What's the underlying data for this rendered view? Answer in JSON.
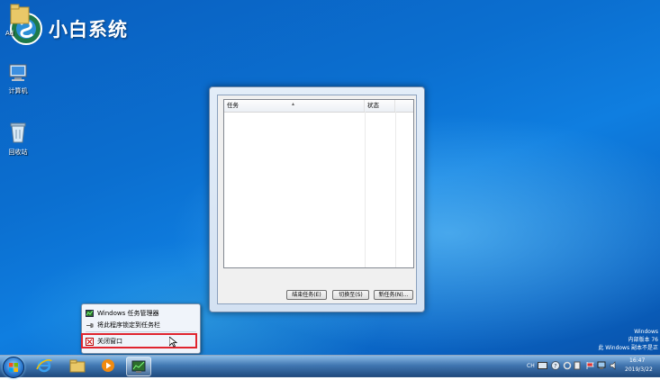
{
  "brand": {
    "name": "小白系统"
  },
  "desktop_icons": [
    {
      "label": "Ad"
    },
    {
      "label": "计算机"
    },
    {
      "label": "回收站"
    }
  ],
  "task_manager": {
    "columns": {
      "task": "任务",
      "status": "状态"
    },
    "buttons": {
      "end_task": "结束任务(E)",
      "switch_to": "切换至(S)",
      "new_task": "新任务(N)..."
    }
  },
  "jump_list": {
    "items": [
      {
        "label": "Windows 任务管理器",
        "icon": "task-manager-icon"
      },
      {
        "label": "将此程序锁定到任务栏",
        "icon": "pin-icon"
      },
      {
        "label": "关闭窗口",
        "icon": "close-window-icon"
      }
    ]
  },
  "watermark": {
    "line1": "Windows",
    "line2": "内部版本 76",
    "line3": "此 Windows 副本不是正"
  },
  "tray": {
    "lang": "CH",
    "time": "16:47",
    "date": "2019/3/22"
  },
  "colors": {
    "highlight": "#e0242e",
    "desktop": "#0b6fd0"
  }
}
